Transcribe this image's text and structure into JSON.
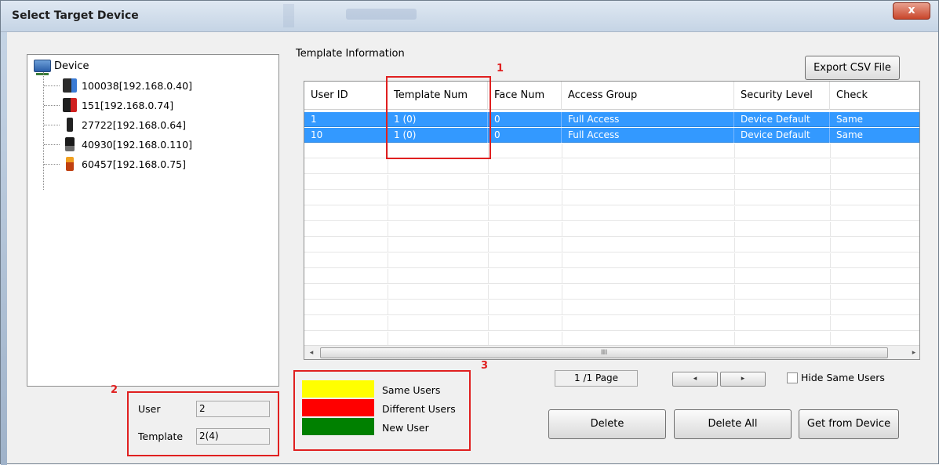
{
  "window": {
    "title": "Select Target Device",
    "close_symbol": "x"
  },
  "tree": {
    "root_label": "Device",
    "root_icon": "network-icon",
    "items": [
      {
        "label": "100038[192.168.0.40]",
        "icon_color": "#2b2b2b",
        "accent": "#3a7bd5"
      },
      {
        "label": "151[192.168.0.74]",
        "icon_color": "#1f1f1f",
        "accent": "#d02020"
      },
      {
        "label": "27722[192.168.0.64]",
        "icon_color": "#222222",
        "accent": "#555555"
      },
      {
        "label": "40930[192.168.0.110]",
        "icon_color": "#1a1a1a",
        "accent": "#6b6b6b"
      },
      {
        "label": "60457[192.168.0.75]",
        "icon_color": "#c04010",
        "accent": "#f0a020"
      }
    ]
  },
  "template_info": {
    "group_label": "Template Information",
    "export_button": "Export CSV File",
    "columns": [
      "User ID",
      "Template Num",
      "Face Num",
      "Access Group",
      "Security Level",
      "Check"
    ],
    "rows": [
      [
        "1",
        "1 (0)",
        "0",
        "Full Access",
        "Device Default",
        "Same"
      ],
      [
        "10",
        "1 (0)",
        "0",
        "Full Access",
        "Device Default",
        "Same"
      ]
    ],
    "scroll_left": "◂",
    "scroll_right": "▸",
    "scroll_grip": "III"
  },
  "annotations": {
    "box1": "1",
    "box2": "2",
    "box3": "3"
  },
  "stats": {
    "user_label": "User",
    "user_value": "2",
    "template_label": "Template",
    "template_value": "2(4)"
  },
  "legend": [
    {
      "label": "Same Users",
      "color": "#ffff00"
    },
    {
      "label": "Different Users",
      "color": "#ff0000"
    },
    {
      "label": "New User",
      "color": "#008000"
    }
  ],
  "pager": {
    "page_text": "1 /1 Page",
    "prev_symbol": "◂",
    "next_symbol": "▸",
    "hide_same_users_label": "Hide Same Users",
    "hide_same_users_checked": false
  },
  "buttons": {
    "delete": "Delete",
    "delete_all": "Delete All",
    "get_from_device": "Get from Device"
  },
  "colors": {
    "selection": "#3399ff",
    "annotation_red": "#e02020"
  }
}
